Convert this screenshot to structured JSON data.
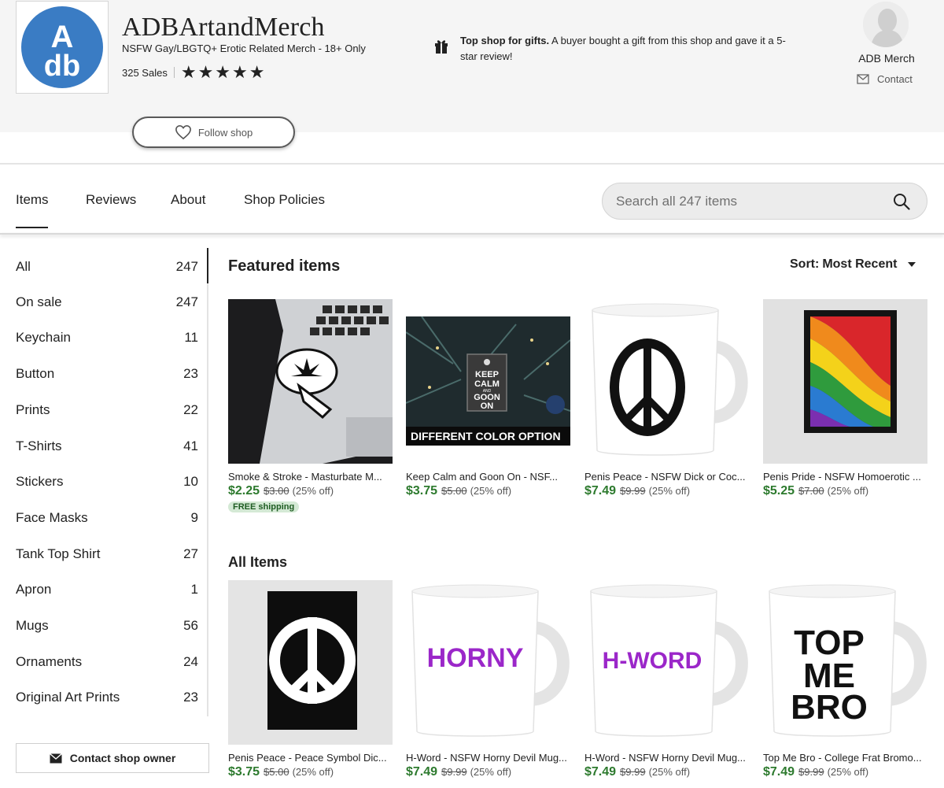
{
  "shop": {
    "logo_text": "Adb",
    "name": "ADBArtandMerch",
    "tagline": "NSFW Gay/LBGTQ+ Erotic Related Merch - 18+ Only",
    "sales": "325 Sales",
    "rating_stars": 5,
    "follow_label": "Follow shop"
  },
  "gift": {
    "bold": "Top shop for gifts.",
    "text": " A buyer bought a gift from this shop and gave it a 5-star review!"
  },
  "owner": {
    "name": "ADB Merch",
    "contact_label": "Contact"
  },
  "tabs": [
    {
      "label": "Items",
      "active": true
    },
    {
      "label": "Reviews"
    },
    {
      "label": "About"
    },
    {
      "label": "Shop Policies"
    }
  ],
  "search": {
    "placeholder": "Search all 247 items",
    "value": ""
  },
  "sidebar": {
    "categories": [
      {
        "label": "All",
        "count": "247"
      },
      {
        "label": "On sale",
        "count": "247"
      },
      {
        "label": "Keychain",
        "count": "11"
      },
      {
        "label": "Button",
        "count": "23"
      },
      {
        "label": "Prints",
        "count": "22"
      },
      {
        "label": "T-Shirts",
        "count": "41"
      },
      {
        "label": "Stickers",
        "count": "10"
      },
      {
        "label": "Face Masks",
        "count": "9"
      },
      {
        "label": "Tank Top Shirt",
        "count": "27"
      },
      {
        "label": "Apron",
        "count": "1"
      },
      {
        "label": "Mugs",
        "count": "56"
      },
      {
        "label": "Ornaments",
        "count": "24"
      },
      {
        "label": "Original Art Prints",
        "count": "23"
      }
    ],
    "contact_owner_label": "Contact shop owner"
  },
  "featured": {
    "title": "Featured items",
    "sort_prefix": "Sort:",
    "sort_value": "Most Recent",
    "items": [
      {
        "title": "Smoke & Stroke - Masturbate M...",
        "price": "$2.25",
        "original": "$3.00",
        "discount": "(25% off)",
        "badge": "FREE shipping"
      },
      {
        "title": "Keep Calm and Goon On - NSF...",
        "price": "$3.75",
        "original": "$5.00",
        "discount": "(25% off)",
        "image_text": [
          "KEEP",
          "CALM",
          "AND",
          "GOON",
          "ON"
        ],
        "banner": "DIFFERENT COLOR OPTION"
      },
      {
        "title": "Penis Peace - NSFW Dick or Coc...",
        "price": "$7.49",
        "original": "$9.99",
        "discount": "(25% off)"
      },
      {
        "title": "Penis Pride - NSFW Homoerotic ...",
        "price": "$5.25",
        "original": "$7.00",
        "discount": "(25% off)"
      }
    ]
  },
  "all_items": {
    "title": "All Items",
    "items": [
      {
        "title": "Penis Peace - Peace Symbol Dic...",
        "price": "$3.75",
        "original": "$5.00",
        "discount": "(25% off)"
      },
      {
        "title": "H-Word - NSFW Horny Devil Mug...",
        "price": "$7.49",
        "original": "$9.99",
        "discount": "(25% off)",
        "image_text": "HORNY"
      },
      {
        "title": "H-Word - NSFW Horny Devil Mug...",
        "price": "$7.49",
        "original": "$9.99",
        "discount": "(25% off)",
        "image_text": "H-WORD"
      },
      {
        "title": "Top Me Bro - College Frat Bromo...",
        "price": "$7.49",
        "original": "$9.99",
        "discount": "(25% off)",
        "image_text": [
          "TOP",
          "ME",
          "BRO"
        ]
      }
    ]
  },
  "colors": {
    "price_green": "#2d7a2e",
    "logo_blue": "#3a7cc4",
    "devil_purple": "#9b27c9",
    "badge_bg": "#d4e9d5"
  },
  "icons": [
    "gift-icon",
    "mail-icon",
    "heart-icon",
    "search-icon",
    "chevron-down-icon",
    "star-icon",
    "envelope-icon"
  ]
}
